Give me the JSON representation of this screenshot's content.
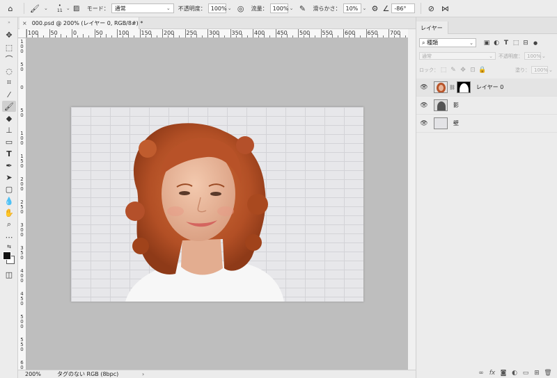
{
  "options_bar": {
    "brush_size": "11",
    "mode_label": "モード：",
    "mode_value": "通常",
    "opacity_label": "不透明度：",
    "opacity_value": "100%",
    "flow_label": "流量：",
    "flow_value": "100%",
    "smoothing_label": "滑らかさ：",
    "smoothing_value": "10%",
    "angle_value": "-86°"
  },
  "document_tab": {
    "title": "000.psd @ 200% (レイヤー 0, RGB/8#) *"
  },
  "ruler": {
    "horizontal_labels": [
      "100",
      "50",
      "0",
      "50",
      "100",
      "150",
      "200",
      "250",
      "300",
      "350",
      "400",
      "450",
      "500",
      "550",
      "600",
      "650",
      "700"
    ],
    "vertical_labels": [
      "1 0 0",
      "5 0",
      "0",
      "5 0",
      "1 0 0",
      "1 5 0",
      "2 0 0",
      "2 5 0",
      "3 0 0",
      "3 5 0",
      "4 0 0",
      "4 5 0",
      "5 0 0",
      "5 5 0",
      "6 0 0"
    ]
  },
  "status_bar": {
    "zoom": "200%",
    "doc_info": "タグのない RGB (8bpc)"
  },
  "layers_panel": {
    "tab_label": "レイヤー",
    "filter_value": "種類",
    "blend_mode": "通常",
    "opacity_label": "不透明度：",
    "opacity_value": "100%",
    "lock_label": "ロック：",
    "fill_label": "塗り：",
    "fill_value": "100%",
    "layers": [
      {
        "name": "レイヤー 0",
        "selected": true
      },
      {
        "name": "影",
        "selected": false
      },
      {
        "name": "壁",
        "selected": false
      }
    ]
  },
  "colors": {
    "canvas_bg": "#bebebe",
    "hair": "#b8552a",
    "skin": "#e7b59a",
    "wall": "#e7e7ea"
  }
}
